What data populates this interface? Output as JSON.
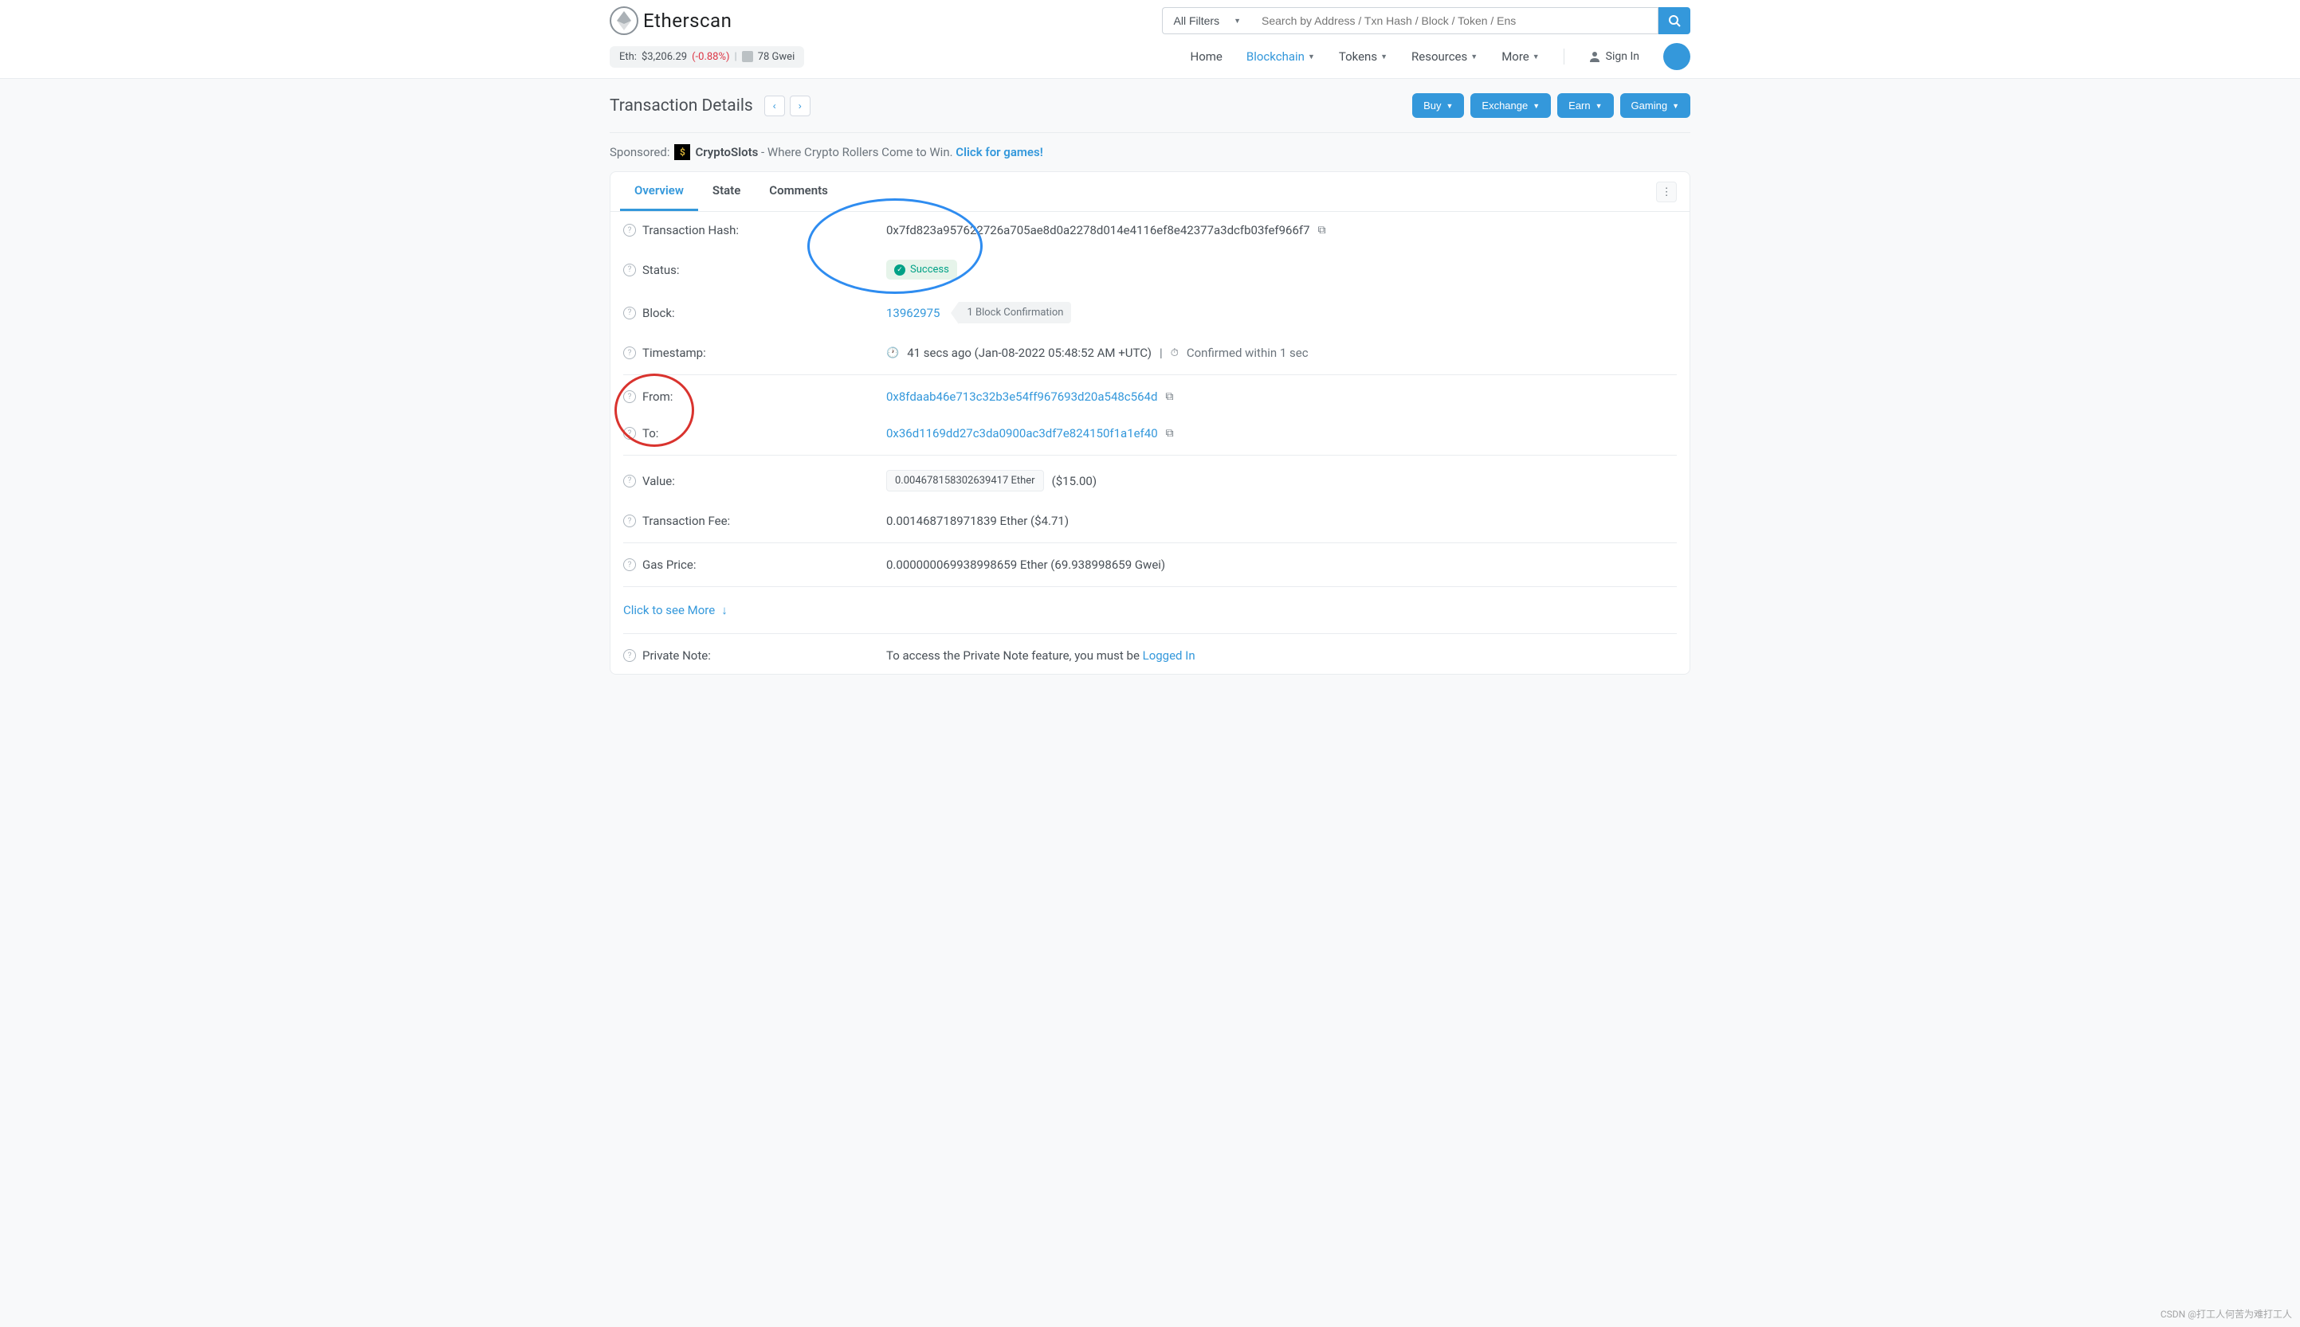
{
  "header": {
    "logo_text": "Etherscan",
    "filter_label": "All Filters",
    "search_placeholder": "Search by Address / Txn Hash / Block / Token / Ens"
  },
  "price_bar": {
    "eth_label": "Eth:",
    "eth_price": "$3,206.29",
    "eth_pct": "(-0.88%)",
    "sep": "|",
    "gwei": "78 Gwei"
  },
  "nav": {
    "home": "Home",
    "blockchain": "Blockchain",
    "tokens": "Tokens",
    "resources": "Resources",
    "more": "More",
    "signin": "Sign In"
  },
  "page": {
    "title": "Transaction Details",
    "buy": "Buy",
    "exchange": "Exchange",
    "earn": "Earn",
    "gaming": "Gaming"
  },
  "sponsored": {
    "label": "Sponsored:",
    "badge": "$",
    "name": "CryptoSlots",
    "text": " - Where Crypto Rollers Come to Win. ",
    "link": "Click for games!"
  },
  "tabs": {
    "overview": "Overview",
    "state": "State",
    "comments": "Comments"
  },
  "tx": {
    "hash_label": "Transaction Hash:",
    "hash": "0x7fd823a957622726a705ae8d0a2278d014e4116ef8e42377a3dcfb03fef966f7",
    "status_label": "Status:",
    "status": "Success",
    "block_label": "Block:",
    "block": "13962975",
    "confirmations": "1 Block Confirmation",
    "timestamp_label": "Timestamp:",
    "timestamp": "41 secs ago (Jan-08-2022 05:48:52 AM +UTC)",
    "confirmed": "Confirmed within 1 sec",
    "from_label": "From:",
    "from": "0x8fdaab46e713c32b3e54ff967693d20a548c564d",
    "to_label": "To:",
    "to": "0x36d1169dd27c3da0900ac3df7e824150f1a1ef40",
    "value_label": "Value:",
    "value_eth": "0.004678158302639417 Ether",
    "value_usd": "($15.00)",
    "fee_label": "Transaction Fee:",
    "fee": "0.001468718971839 Ether ($4.71)",
    "gas_label": "Gas Price:",
    "gas": "0.000000069938998659 Ether (69.938998659 Gwei)",
    "see_more": "Click to see More",
    "note_label": "Private Note:",
    "note_text": "To access the Private Note feature, you must be ",
    "note_link": "Logged In"
  },
  "watermark": "CSDN @打工人何苦为难打工人"
}
